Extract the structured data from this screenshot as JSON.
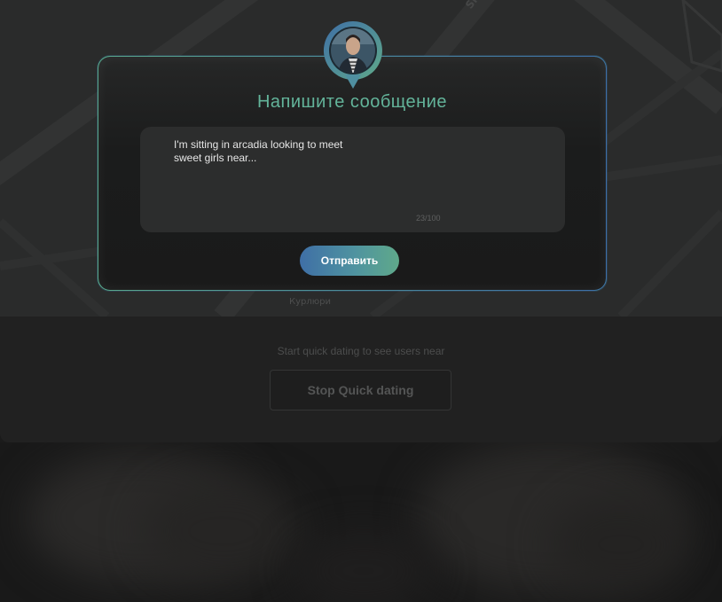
{
  "map": {
    "street_label": "Shos",
    "district_label": "Курлюри"
  },
  "modal": {
    "avatar_icon": "user-avatar-pin",
    "title": "Напишите сообщение",
    "message_text": "I'm sitting in arcadia looking to meet sweet girls near...",
    "char_count": "23/100",
    "send_label": "Отправить"
  },
  "quick_dating": {
    "hint": "Start quick dating to see users near",
    "stop_label": "Stop Quick dating"
  },
  "colors": {
    "accent_green": "#63b49a",
    "accent_blue": "#3f6fa6",
    "background": "#1b1b1b"
  }
}
